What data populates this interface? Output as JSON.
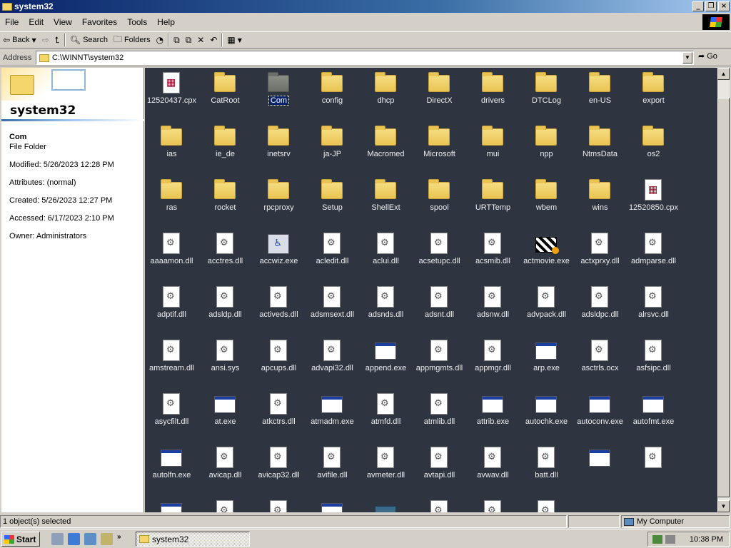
{
  "window": {
    "title": "system32"
  },
  "menu": [
    "File",
    "Edit",
    "View",
    "Favorites",
    "Tools",
    "Help"
  ],
  "toolbar": {
    "back": "Back",
    "search": "Search",
    "folders": "Folders"
  },
  "address": {
    "label": "Address",
    "path": "C:\\WINNT\\system32",
    "go": "Go"
  },
  "details": {
    "folder_title": "system32",
    "selected_name": "Com",
    "selected_type": "File Folder",
    "modified": "Modified: 5/26/2023 12:28 PM",
    "attributes": "Attributes: (normal)",
    "created": "Created: 5/26/2023 12:27 PM",
    "accessed": "Accessed: 6/17/2023 2:10 PM",
    "owner": "Owner: Administrators"
  },
  "items": [
    {
      "label": "12520437.cpx",
      "icon": "doc cpx"
    },
    {
      "label": "CatRoot",
      "icon": "folder"
    },
    {
      "label": "Com",
      "icon": "folder grey"
    },
    {
      "label": "config",
      "icon": "folder"
    },
    {
      "label": "dhcp",
      "icon": "folder"
    },
    {
      "label": "DirectX",
      "icon": "folder"
    },
    {
      "label": "drivers",
      "icon": "folder"
    },
    {
      "label": "DTCLog",
      "icon": "folder"
    },
    {
      "label": "en-US",
      "icon": "folder"
    },
    {
      "label": "export",
      "icon": "folder"
    },
    {
      "label": "ias",
      "icon": "folder"
    },
    {
      "label": "ie_de",
      "icon": "folder"
    },
    {
      "label": "inetsrv",
      "icon": "folder"
    },
    {
      "label": "ja-JP",
      "icon": "folder"
    },
    {
      "label": "Macromed",
      "icon": "folder"
    },
    {
      "label": "Microsoft",
      "icon": "folder"
    },
    {
      "label": "mui",
      "icon": "folder"
    },
    {
      "label": "npp",
      "icon": "folder"
    },
    {
      "label": "NtmsData",
      "icon": "folder"
    },
    {
      "label": "os2",
      "icon": "folder"
    },
    {
      "label": "ras",
      "icon": "folder"
    },
    {
      "label": "rocket",
      "icon": "folder"
    },
    {
      "label": "rpcproxy",
      "icon": "folder"
    },
    {
      "label": "Setup",
      "icon": "folder"
    },
    {
      "label": "ShellExt",
      "icon": "folder"
    },
    {
      "label": "spool",
      "icon": "folder"
    },
    {
      "label": "URTTemp",
      "icon": "folder"
    },
    {
      "label": "wbem",
      "icon": "folder"
    },
    {
      "label": "wins",
      "icon": "folder"
    },
    {
      "label": "12520850.cpx",
      "icon": "doc cpx"
    },
    {
      "label": "aaaamon.dll",
      "icon": "doc"
    },
    {
      "label": "acctres.dll",
      "icon": "doc"
    },
    {
      "label": "accwiz.exe",
      "icon": "wiz"
    },
    {
      "label": "acledit.dll",
      "icon": "doc"
    },
    {
      "label": "aclui.dll",
      "icon": "doc"
    },
    {
      "label": "acsetupc.dll",
      "icon": "doc"
    },
    {
      "label": "acsmib.dll",
      "icon": "doc"
    },
    {
      "label": "actmovie.exe",
      "icon": "clap"
    },
    {
      "label": "actxprxy.dll",
      "icon": "doc"
    },
    {
      "label": "admparse.dll",
      "icon": "doc"
    },
    {
      "label": "adptif.dll",
      "icon": "doc"
    },
    {
      "label": "adsldp.dll",
      "icon": "doc"
    },
    {
      "label": "activeds.dll",
      "icon": "doc"
    },
    {
      "label": "adsmsext.dll",
      "icon": "doc"
    },
    {
      "label": "adsnds.dll",
      "icon": "doc"
    },
    {
      "label": "adsnt.dll",
      "icon": "doc"
    },
    {
      "label": "adsnw.dll",
      "icon": "doc"
    },
    {
      "label": "advpack.dll",
      "icon": "doc"
    },
    {
      "label": "adsldpc.dll",
      "icon": "doc"
    },
    {
      "label": "alrsvc.dll",
      "icon": "doc"
    },
    {
      "label": "amstream.dll",
      "icon": "doc"
    },
    {
      "label": "ansi.sys",
      "icon": "doc"
    },
    {
      "label": "apcups.dll",
      "icon": "doc"
    },
    {
      "label": "advapi32.dll",
      "icon": "doc"
    },
    {
      "label": "append.exe",
      "icon": "exe"
    },
    {
      "label": "appmgmts.dll",
      "icon": "doc"
    },
    {
      "label": "appmgr.dll",
      "icon": "doc"
    },
    {
      "label": "arp.exe",
      "icon": "exe"
    },
    {
      "label": "asctrls.ocx",
      "icon": "doc"
    },
    {
      "label": "asfsipc.dll",
      "icon": "doc"
    },
    {
      "label": "asycfilt.dll",
      "icon": "doc"
    },
    {
      "label": "at.exe",
      "icon": "exe"
    },
    {
      "label": "atkctrs.dll",
      "icon": "doc"
    },
    {
      "label": "atmadm.exe",
      "icon": "exe"
    },
    {
      "label": "atmfd.dll",
      "icon": "doc"
    },
    {
      "label": "atmlib.dll",
      "icon": "doc"
    },
    {
      "label": "attrib.exe",
      "icon": "exe"
    },
    {
      "label": "autochk.exe",
      "icon": "exe"
    },
    {
      "label": "autoconv.exe",
      "icon": "exe"
    },
    {
      "label": "autofmt.exe",
      "icon": "exe"
    },
    {
      "label": "autolfn.exe",
      "icon": "exe"
    },
    {
      "label": "avicap.dll",
      "icon": "doc"
    },
    {
      "label": "avicap32.dll",
      "icon": "doc"
    },
    {
      "label": "avifile.dll",
      "icon": "doc"
    },
    {
      "label": "avmeter.dll",
      "icon": "doc"
    },
    {
      "label": "avtapi.dll",
      "icon": "doc"
    },
    {
      "label": "avwav.dll",
      "icon": "doc"
    },
    {
      "label": "batt.dll",
      "icon": "doc"
    },
    {
      "label": "",
      "icon": "exe"
    },
    {
      "label": "",
      "icon": "doc"
    },
    {
      "label": "",
      "icon": "exe"
    },
    {
      "label": "",
      "icon": "doc"
    },
    {
      "label": "",
      "icon": "doc"
    },
    {
      "label": "",
      "icon": "exe"
    },
    {
      "label": "",
      "icon": "kbd"
    },
    {
      "label": "",
      "icon": "doc"
    },
    {
      "label": "",
      "icon": "doc"
    },
    {
      "label": "",
      "icon": "doc"
    }
  ],
  "status": {
    "selected": "1 object(s) selected",
    "zone": "My Computer"
  },
  "taskbar": {
    "start": "Start",
    "task": "system32",
    "clock": "10:38 PM"
  },
  "colors": {
    "view_background": "#2e3440",
    "titlebar": "#0a246a",
    "selection": "#0a246a"
  }
}
